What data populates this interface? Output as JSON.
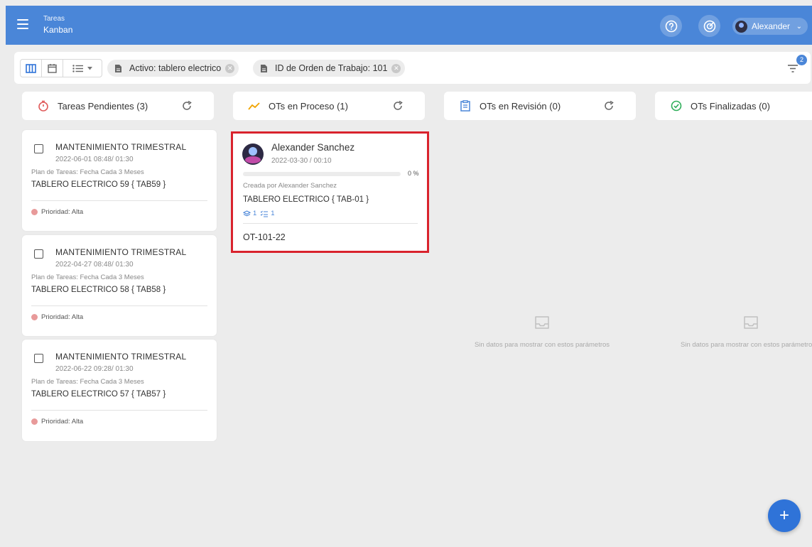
{
  "header": {
    "title": "Tareas",
    "subtitle": "Kanban",
    "user_name": "Alexander",
    "accent_color": "#4a86d8"
  },
  "filters": {
    "chips": [
      {
        "label": "Activo: tablero electrico"
      },
      {
        "label": "ID de Orden de Trabajo: 101"
      }
    ],
    "badge_count": "2"
  },
  "columns": [
    {
      "title": "Tareas Pendientes (3)",
      "icon": "stopwatch-icon",
      "icon_color": "#e05b5b"
    },
    {
      "title": "OTs en Proceso (1)",
      "icon": "trend-icon",
      "icon_color": "#f0a400"
    },
    {
      "title": "OTs en Revisión (0)",
      "icon": "clipboard-icon",
      "icon_color": "#4a86d8"
    },
    {
      "title": "OTs Finalizadas (0)",
      "icon": "check-circle-icon",
      "icon_color": "#2fae5a"
    }
  ],
  "pending_tasks": [
    {
      "title": "MANTENIMIENTO TRIMESTRAL",
      "date": "2022-06-01 08:48/ 01:30",
      "plan": "Plan de Tareas: Fecha Cada 3 Meses",
      "asset": "TABLERO ELECTRICO 59 { TAB59 }",
      "priority": "Prioridad: Alta"
    },
    {
      "title": "MANTENIMIENTO TRIMESTRAL",
      "date": "2022-04-27 08:48/ 01:30",
      "plan": "Plan de Tareas: Fecha Cada 3 Meses",
      "asset": "TABLERO ELECTRICO 58 { TAB58 }",
      "priority": "Prioridad: Alta"
    },
    {
      "title": "MANTENIMIENTO TRIMESTRAL",
      "date": "2022-06-22 09:28/ 01:30",
      "plan": "Plan de Tareas: Fecha Cada 3 Meses",
      "asset": "TABLERO ELECTRICO 57 { TAB57 }",
      "priority": "Prioridad: Alta"
    }
  ],
  "in_process": [
    {
      "assignee": "Alexander Sanchez",
      "date": "2022-03-30 / 00:10",
      "progress": 0,
      "progress_label": "0 %",
      "created_by": "Creada por Alexander Sanchez",
      "asset": "TABLERO ELECTRICO { TAB-01 }",
      "meta_count_a": "1",
      "meta_count_b": "1",
      "code": "OT-101-22"
    }
  ],
  "empty_message": "Sin datos para mostrar con estos parámetros"
}
